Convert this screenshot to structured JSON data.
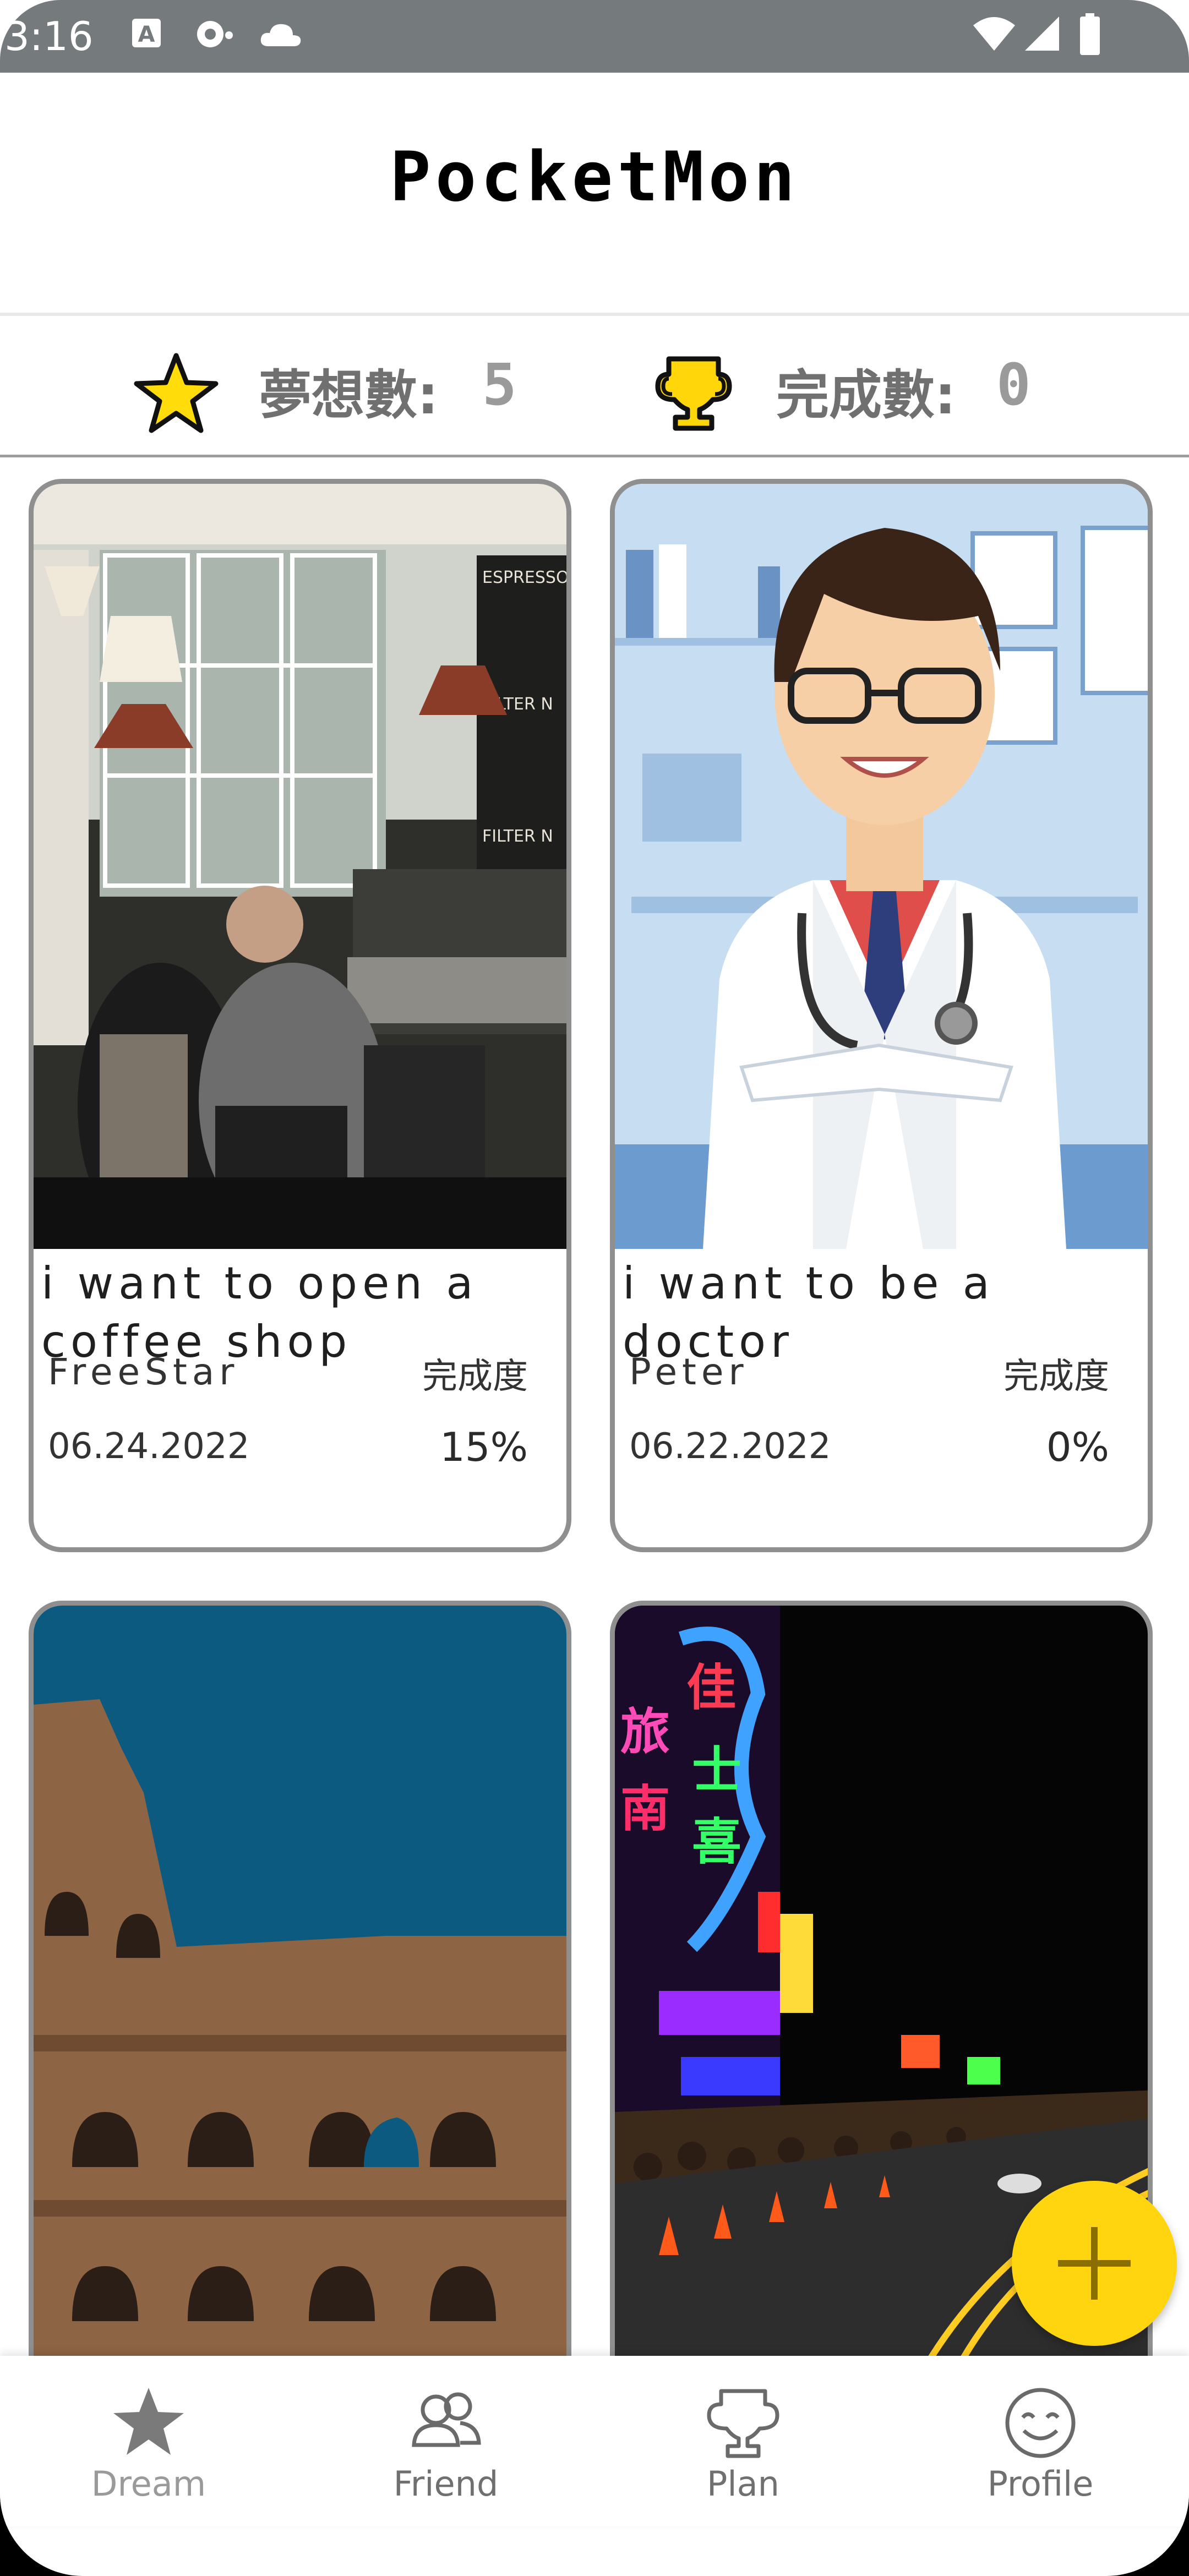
{
  "status_bar": {
    "time": "3:16",
    "icons": [
      "a-notification-icon",
      "sync-notification-icon",
      "cloud-icon",
      "wifi-icon",
      "signal-icon",
      "battery-icon"
    ]
  },
  "header": {
    "title": "PocketMon"
  },
  "stats": {
    "dreams": {
      "label": "夢想數:",
      "value": "5",
      "icon": "star-icon"
    },
    "completed": {
      "label": "完成數:",
      "value": "0",
      "icon": "trophy-icon"
    }
  },
  "cards": [
    {
      "title": "i want to open a coffee shop",
      "owner": "FreeStar",
      "progress_label": "完成度",
      "date": "06.24.2022",
      "progress": "15%",
      "image": "coffee-shop-photo"
    },
    {
      "title": "i want to be a doctor",
      "owner": "Peter",
      "progress_label": "完成度",
      "date": "06.22.2022",
      "progress": "0%",
      "image": "doctor-illustration"
    },
    {
      "title": "",
      "owner": "",
      "progress_label": "",
      "date": "",
      "progress": "",
      "image": "colosseum-photo"
    },
    {
      "title": "",
      "owner": "",
      "progress_label": "",
      "date": "",
      "progress": "",
      "image": "night-market-photo"
    }
  ],
  "fab": {
    "icon": "plus-icon",
    "color": "#ffd50f"
  },
  "bottom_nav": [
    {
      "label": "Dream",
      "icon": "star-icon",
      "active": true
    },
    {
      "label": "Friend",
      "icon": "friends-icon",
      "active": false
    },
    {
      "label": "Plan",
      "icon": "trophy-icon",
      "active": false
    },
    {
      "label": "Profile",
      "icon": "smiley-icon",
      "active": false
    }
  ],
  "colors": {
    "accent": "#ffd50f",
    "status_bar": "#757b7c",
    "card_border": "#8f8f8f",
    "nav_text": "#707070"
  }
}
